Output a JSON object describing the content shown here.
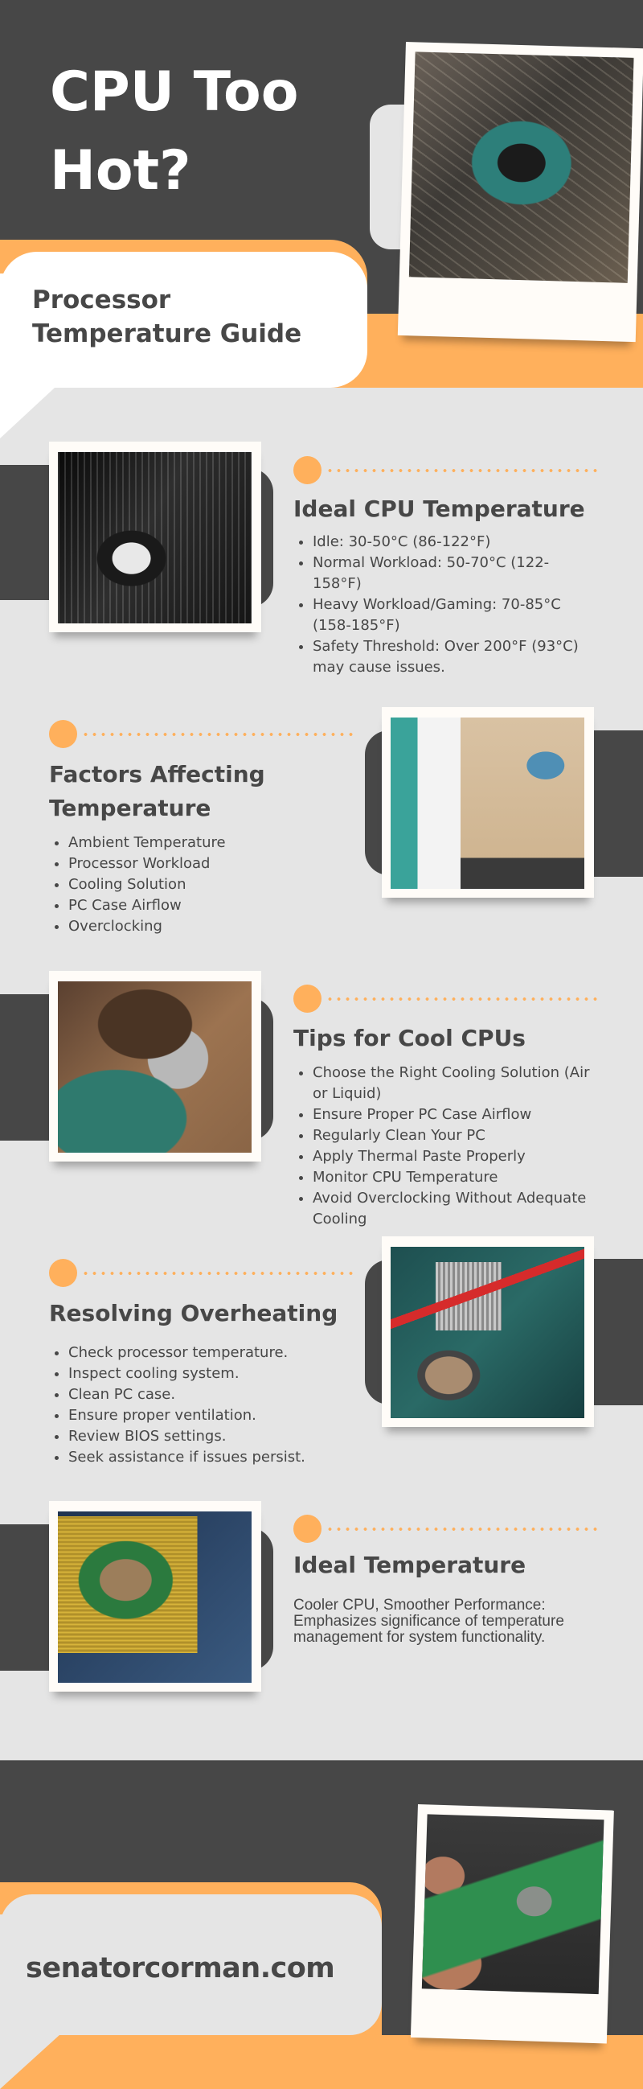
{
  "header": {
    "title_line1": "CPU Too",
    "title_line2": "Hot?",
    "subtitle_line1": "Processor",
    "subtitle_line2": "Temperature Guide"
  },
  "sections": [
    {
      "heading": "Ideal CPU Temperature",
      "items": [
        "Idle: 30-50°C (86-122°F)",
        "Normal Workload: 50-70°C (122-158°F)",
        "Heavy Workload/Gaming: 70-85°C (158-185°F)",
        "Safety Threshold: Over 200°F (93°C) may cause issues."
      ],
      "image": "black-white-motherboard-photo"
    },
    {
      "heading": "Factors Affecting Temperature",
      "items": [
        "Ambient Temperature",
        "Processor Workload",
        "Cooling Solution",
        "PC Case Airflow",
        "Overclocking"
      ],
      "image": "people-inspecting-hardware-photo"
    },
    {
      "heading": "Tips for Cool CPUs",
      "items": [
        "Choose the Right Cooling Solution (Air or Liquid)",
        "Ensure Proper PC Case Airflow",
        "Regularly Clean Your PC",
        "Apply Thermal Paste Properly",
        "Monitor CPU Temperature",
        "Avoid Overclocking Without Adequate Cooling"
      ],
      "image": "kid-assembling-pc-photo"
    },
    {
      "heading": "Resolving Overheating",
      "items": [
        "Check processor temperature.",
        "Inspect cooling system.",
        "Clean PC case.",
        "Ensure proper ventilation.",
        "Review BIOS settings.",
        "Seek assistance if issues persist."
      ],
      "image": "motherboard-heatsink-photo"
    },
    {
      "heading": "Ideal Temperature",
      "paragraph": "Cooler CPU, Smoother Performance: Emphasizes significance of temperature management for system functionality.",
      "image": "cpu-chip-pins-photo"
    }
  ],
  "footer": {
    "site": "senatorcorman.com"
  },
  "colors": {
    "dark": "#474747",
    "accent": "#ffb05c",
    "light": "#e5e5e5",
    "white": "#ffffff"
  }
}
